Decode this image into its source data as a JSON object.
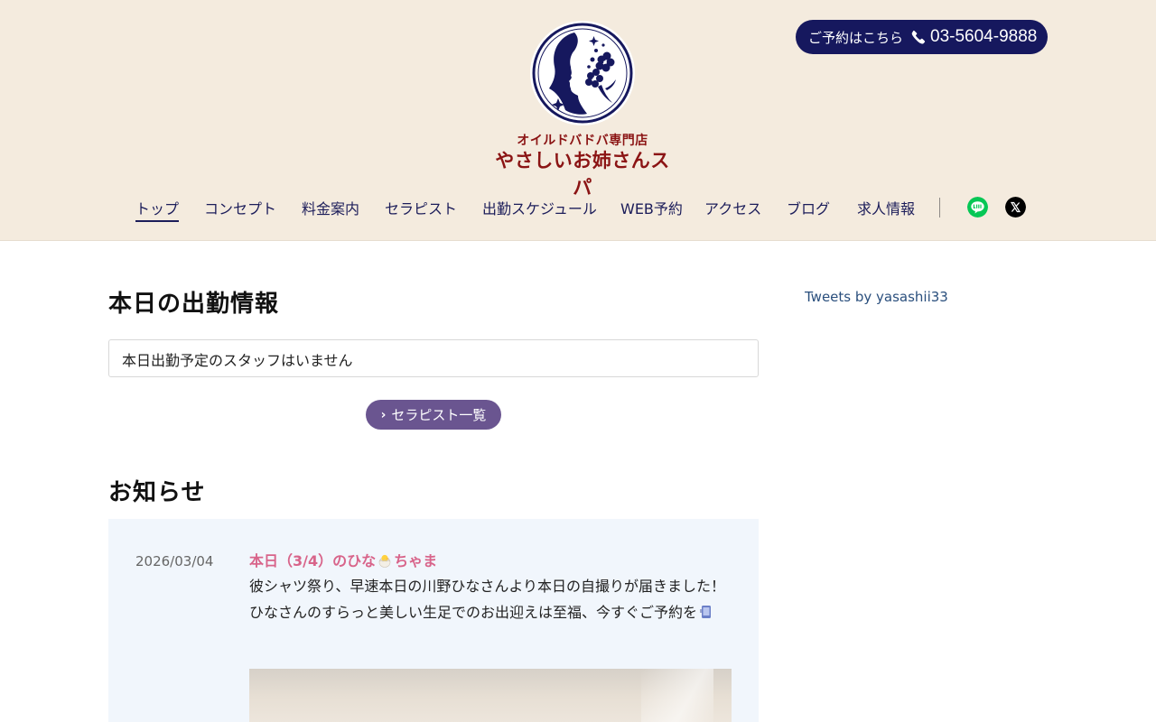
{
  "header": {
    "logo_sub": "オイルドバドバ専門店",
    "logo_main": "やさしいお姉さんスパ",
    "reserve_label": "ご予約はこちら",
    "reserve_number": "03-5604-9888"
  },
  "nav": {
    "items": [
      "トップ",
      "コンセプト",
      "料金案内",
      "セラピスト",
      "出勤スケジュール",
      "WEB予約",
      "アクセス",
      "ブログ",
      "求人情報"
    ],
    "active": "トップ",
    "sns": [
      "line-icon",
      "x-icon"
    ]
  },
  "main": {
    "today_title": "本日の出勤情報",
    "today_notice": "本日出勤予定のスタッフはいません",
    "therapist_button": "セラピスト一覧",
    "news_title": "お知らせ",
    "news": {
      "date": "2026/03/04",
      "title_a": "本日（3/4）のひな",
      "title_b": "ちゃま",
      "body_a": "彼シャツ祭り、早速本日の川野ひなさんより本日の自撮りが届きました！ひなさんのすらっと美しい生足でのお出迎えは至福、今すぐご予約を",
      "title_emoji": "hatching-chick-icon",
      "body_emoji": "mobile-phone-icon"
    }
  },
  "sidebar": {
    "tweets_link": "Tweets by yasashii33"
  },
  "colors": {
    "header_bg": "#f4ebde",
    "navy": "#16185e",
    "logo_red": "#8b1414",
    "button_purple": "#6a5590",
    "news_bg": "#f1f6fc",
    "news_title": "#d8648a",
    "line_green": "#06c755"
  }
}
